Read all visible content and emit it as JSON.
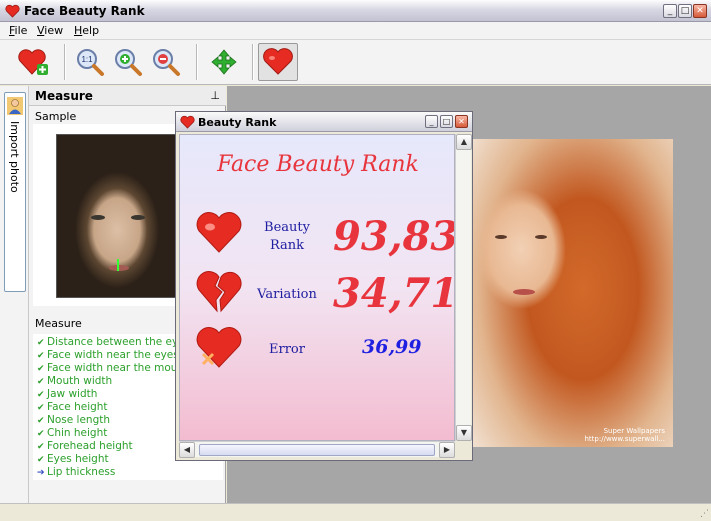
{
  "window": {
    "title": "Face Beauty Rank",
    "minimize": "_",
    "maximize": "□",
    "close": "✕"
  },
  "menu": {
    "file": "File",
    "view": "View",
    "help": "Help"
  },
  "toolbar": {
    "buttons": [
      "add-photo",
      "zoom-actual-size",
      "zoom-in",
      "zoom-out",
      "fit-to-window",
      "beauty-rank"
    ],
    "zoom_1to1_label": "1:1"
  },
  "side_tab": {
    "label": "Import photo",
    "icon": "person-icon"
  },
  "panel": {
    "title": "Measure",
    "pin": "⊥",
    "sample_label": "Sample",
    "measure_label": "Measure",
    "items": [
      "Distance between the eyes",
      "Face width near the eyes",
      "Face width near the mouth",
      "Mouth width",
      "Jaw width",
      "Face height",
      "Nose length",
      "Chin height",
      "Forehead height",
      "Eyes height",
      "Lip thickness"
    ],
    "current_index": 10
  },
  "photo_caption": "Super Wallpapers\nhttp://www.superwall...",
  "dialog": {
    "title": "Beauty Rank",
    "heading": "Face Beauty Rank",
    "rows": [
      {
        "label": "Beauty Rank",
        "value": "93,83",
        "icon": "heart-icon"
      },
      {
        "label": "Variation",
        "value": "34,71",
        "icon": "broken-heart-icon"
      },
      {
        "label": "Error",
        "value": "36,99",
        "icon": "crossed-heart-icon"
      }
    ]
  },
  "colors": {
    "accent_red": "#e8343c",
    "label_blue": "#1d1da0",
    "error_blue": "#1f1fe2",
    "check_green": "#2ca02c"
  }
}
